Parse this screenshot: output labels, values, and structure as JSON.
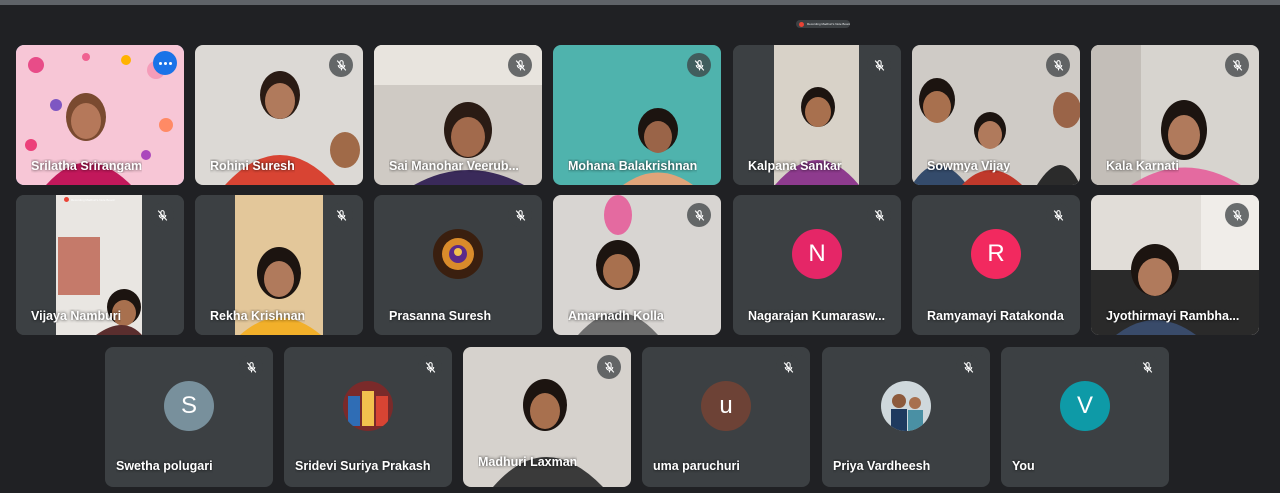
{
  "meeting": {
    "recording_banner": "Recording Madhuri's Note Board"
  },
  "participants": [
    {
      "name": "Srilatha Srirangam",
      "active_speaker": true
    },
    {
      "name": "Rohini Suresh"
    },
    {
      "name": "Sai Manohar Veerub..."
    },
    {
      "name": "Mohana Balakrishnan"
    },
    {
      "name": "Kalpana Sankar"
    },
    {
      "name": "Sowmya Vijay"
    },
    {
      "name": "Kala Karnati"
    },
    {
      "name": "Vijaya Namburi"
    },
    {
      "name": "Rekha Krishnan"
    },
    {
      "name": "Prasanna Suresh"
    },
    {
      "name": "Amarnadh Kolla"
    },
    {
      "name": "Nagarajan Kumarasw..."
    },
    {
      "name": "Ramyamayi Ratakonda"
    },
    {
      "name": "Jyothirmayi Rambha..."
    },
    {
      "name": "Swetha polugari"
    },
    {
      "name": "Sridevi Suriya Prakash"
    },
    {
      "name": "Madhuri Laxman"
    },
    {
      "name": "uma paruchuri"
    },
    {
      "name": "Priya Vardheesh"
    },
    {
      "name": "You"
    }
  ],
  "avatars": {
    "nagarajan": {
      "letter": "N",
      "color": "#e52667"
    },
    "ramyamayi": {
      "letter": "R",
      "color": "#f2295f"
    },
    "swetha": {
      "letter": "S",
      "color": "#78909c"
    },
    "uma": {
      "letter": "u",
      "color": "#6d4236"
    },
    "you": {
      "letter": "V",
      "color": "#0e9aa7"
    }
  },
  "icons": {
    "mute": "mic-off-icon",
    "options": "more-options-icon"
  },
  "colors": {
    "background": "#202124",
    "tile": "#3c4043",
    "active_outline": "#8ab4f8",
    "options_button": "#1a73e8"
  }
}
